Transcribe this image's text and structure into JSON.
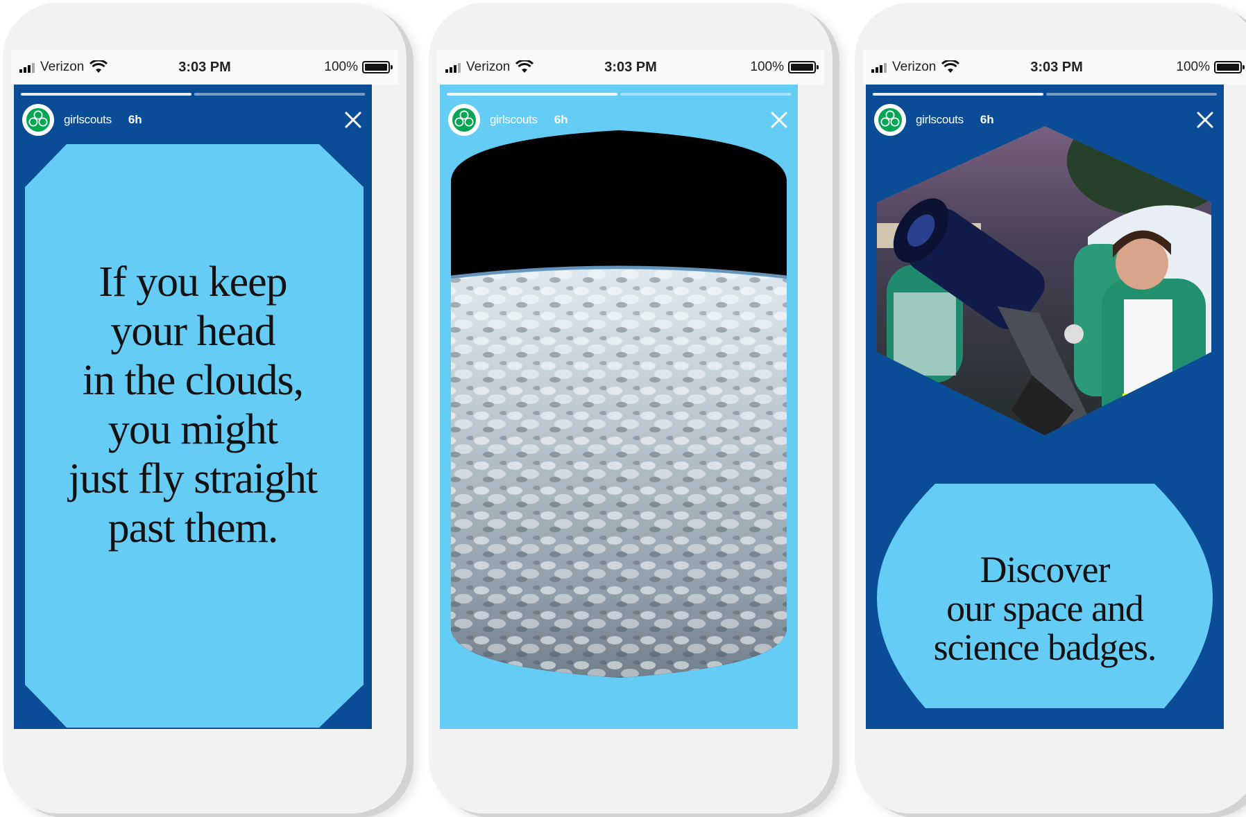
{
  "status_bar": {
    "carrier": "Verizon",
    "time": "3:03 PM",
    "battery": "100%",
    "battery_level": 1.0
  },
  "stories": [
    {
      "username": "girlscouts",
      "age": "6h",
      "quote": [
        "If you keep",
        "your head",
        "in the clouds,",
        "you might",
        "just fly straight",
        "past them."
      ]
    },
    {
      "username": "girlscouts",
      "age": "6h",
      "image": "earth-from-orbit-photo"
    },
    {
      "username": "girlscouts",
      "age": "6h",
      "image": "girl-scouts-telescope-photo",
      "quote": [
        "Discover",
        "our space and",
        "science badges."
      ]
    }
  ],
  "colors": {
    "navy": "#0a4d96",
    "light_blue": "#65ccf5",
    "brand_green": "#00a651",
    "white": "#ffffff"
  },
  "icons": [
    "signal-icon",
    "wifi-icon",
    "battery-icon",
    "trefoil-logo-icon",
    "close-icon"
  ]
}
